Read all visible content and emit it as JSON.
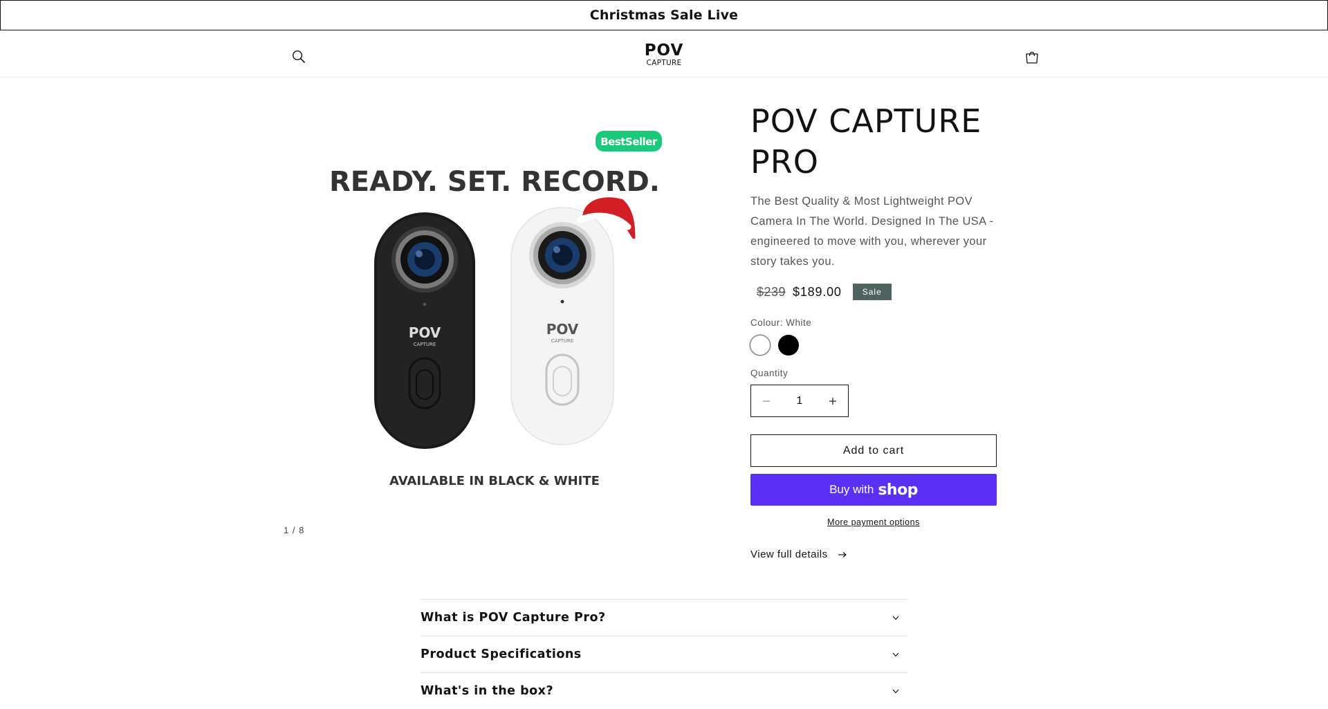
{
  "announcement": {
    "text": "Christmas Sale Live"
  },
  "header": {
    "logo_main": "POV",
    "logo_sub": "CAPTURE"
  },
  "gallery": {
    "headline": "READY. SET. RECORD.",
    "badge": "BestSeller",
    "camera_logo_main": "POV",
    "camera_logo_sub": "CAPTURE",
    "caption": "AVAILABLE IN BLACK & WHITE",
    "counter": "1 / 8"
  },
  "product": {
    "title": "POV CAPTURE PRO",
    "description": "The Best Quality & Most Lightweight POV Camera In The World. Designed In The USA - engineered to move with you, wherever your story takes you.",
    "price_old": "$239",
    "price_new": "$189.00",
    "sale_badge": "Sale",
    "colour_label": "Colour: White",
    "colours": [
      "White",
      "Black"
    ],
    "selected_colour": "White",
    "quantity_label": "Quantity",
    "quantity": "1",
    "add_to_cart": "Add to cart",
    "buy_with": "Buy with",
    "buy_brand": "shop",
    "more_payment": "More payment options",
    "view_details": "View full details"
  },
  "accordion": {
    "items": [
      {
        "title": "What is POV Capture Pro?"
      },
      {
        "title": "Product Specifications"
      },
      {
        "title": "What's in the box?"
      }
    ]
  },
  "colors": {
    "shop_pay": "#5a31f4",
    "sale_badge": "#4f6260",
    "bestseller": "#1cc97a"
  }
}
